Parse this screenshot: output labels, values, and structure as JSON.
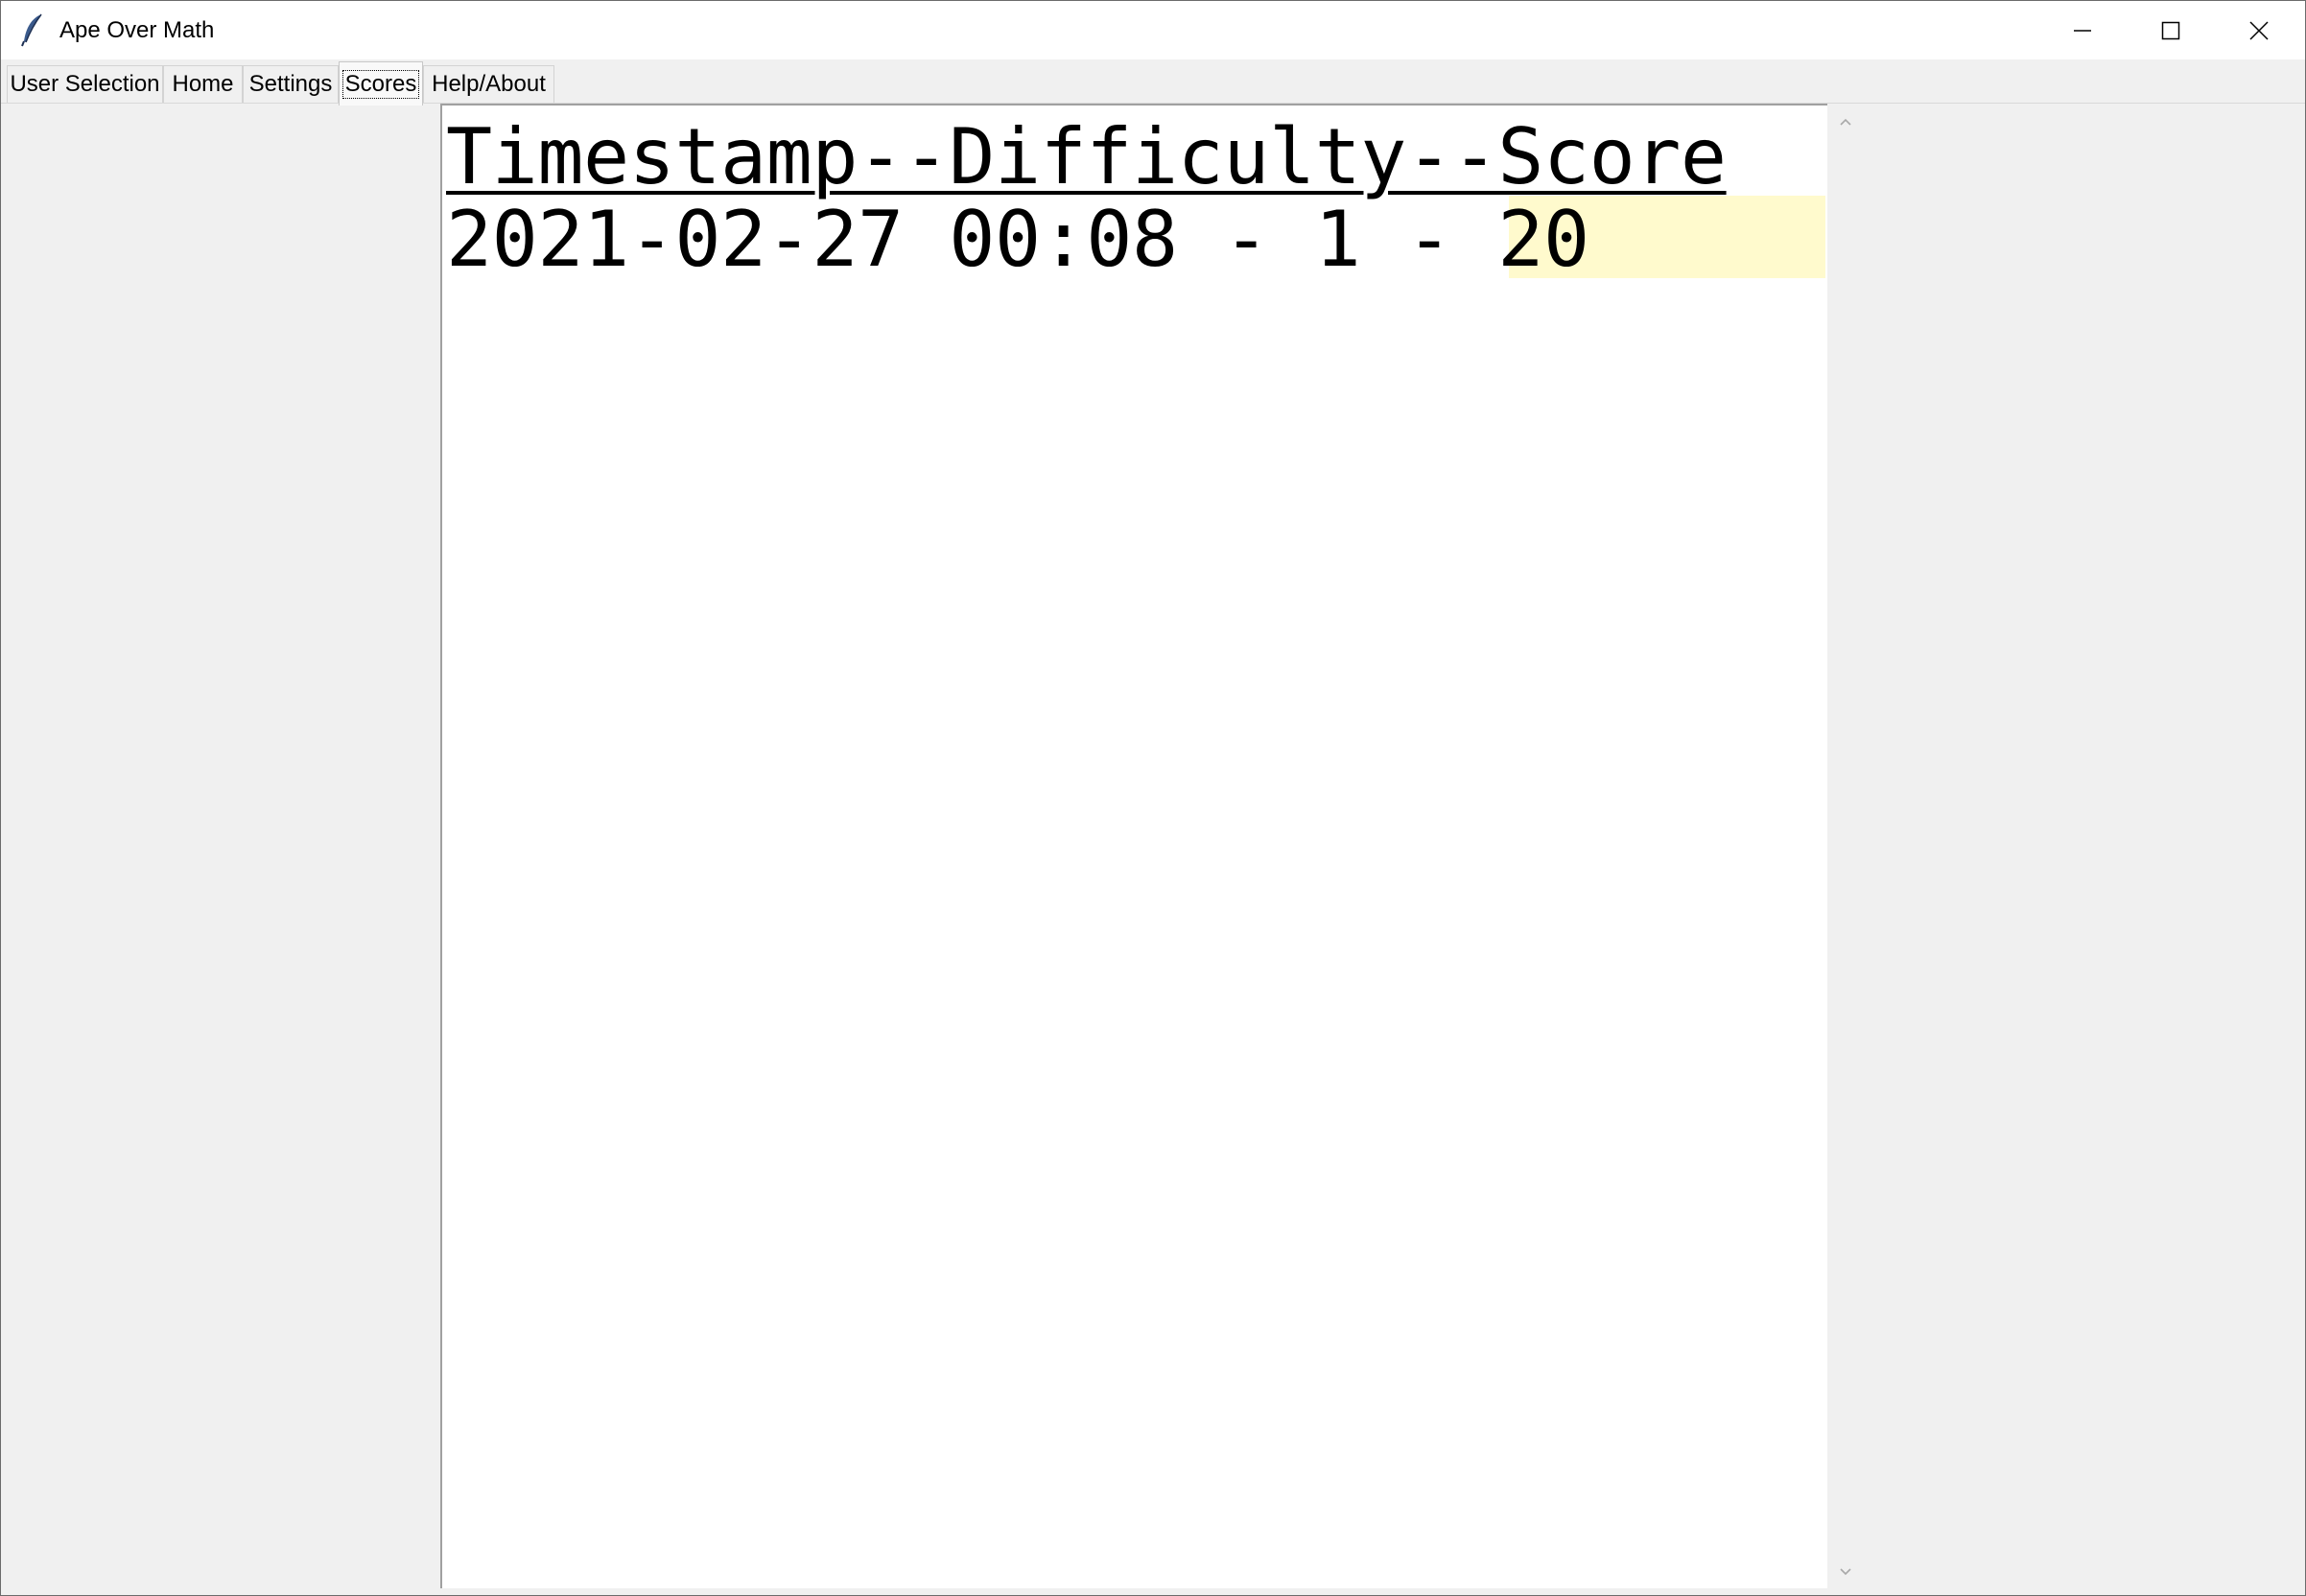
{
  "window": {
    "title": "Ape Over Math",
    "app_icon": "feather-icon",
    "controls": {
      "minimize": "minimize-icon",
      "maximize": "maximize-icon",
      "close": "close-icon"
    }
  },
  "tabs": [
    {
      "label": "User Selection",
      "active": false
    },
    {
      "label": "Home",
      "active": false
    },
    {
      "label": "Settings",
      "active": false
    },
    {
      "label": "Scores",
      "active": true
    },
    {
      "label": "Help/About",
      "active": false
    }
  ],
  "scores": {
    "header": "Timestamp--Difficulty--Score",
    "rows": [
      {
        "timestamp": "2021-02-27 00:08",
        "difficulty": "1",
        "score": "20",
        "line": "2021-02-27 00:08 - 1 - 20"
      }
    ],
    "highlight_color": "#fffacd"
  },
  "scrollbar": {
    "up_icon": "scroll-up-arrow-icon",
    "down_icon": "scroll-down-arrow-icon"
  }
}
